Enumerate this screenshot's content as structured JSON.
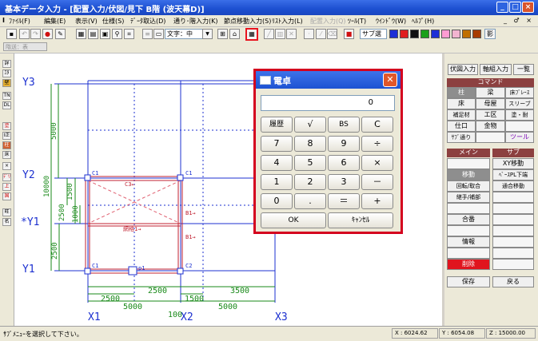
{
  "window": {
    "title": "基本データ入力 - [配置入力/伏図/見下 B階 (波天幕D)]",
    "controls": [
      "_",
      "□",
      "×"
    ]
  },
  "menu": [
    "ﾌｧｲﾙ(F)",
    "編集(E)",
    "表示(V)",
    "仕様(S)",
    "ﾃﾞｰﾀ取込(D)",
    "通り･階入力(K)",
    "節点移動入力(S)",
    "ﾘｽﾄ入力(L)",
    "配置入力(Q)",
    "ﾂｰﾙ(T)",
    "ｳｲﾝﾄﾞｳ(W)",
    "ﾍﾙﾌﾟ(H)"
  ],
  "menu_disabled": [
    "配置入力(Q)"
  ],
  "mdi_controls": "_ ♂ ×",
  "toolbar": {
    "text_select": "文字：中",
    "label_sub": "サブ選",
    "swatch_colors": [
      "#1d2fd6",
      "#e01e1e",
      "#111111",
      "#1aa01a",
      "#1d2fd6",
      "#ff9bd2",
      "#f2b4d0",
      "#c07000",
      "#a83c00"
    ],
    "label_shadow": "影"
  },
  "subbar": {
    "select_value": "階送：表"
  },
  "left_tools": [
    "詳",
    "ｴﾀ",
    "壁",
    "TN",
    "DL",
    "塗",
    "I正",
    "柱",
    "床",
    "×",
    "ﾃﾞﾘ",
    "上",
    "国",
    "旺",
    "名"
  ],
  "drawing": {
    "axis_y": [
      "Y3",
      "Y2",
      "*Y1",
      "Y1"
    ],
    "axis_x": [
      "X1",
      "X2",
      "X3"
    ],
    "dim_vertical": [
      "5000",
      "10000",
      "1500",
      "2500",
      "1000",
      "2500"
    ],
    "dim_horizontal_upper": [
      "2500",
      "3500"
    ],
    "dim_horizontal_mid": [
      "2500",
      "1500"
    ],
    "dim_horizontal_lower": [
      "5000",
      "5000"
    ],
    "dim_total": "100",
    "labels": [
      "C1",
      "C1",
      "C1",
      "C2",
      "C3←",
      "B1→",
      "B1→",
      "p1",
      "網格1→"
    ]
  },
  "calculator": {
    "title": "電卓",
    "display": "0",
    "keys": [
      [
        "履歴",
        "√",
        "BS",
        "C"
      ],
      [
        "7",
        "8",
        "9",
        "÷"
      ],
      [
        "4",
        "5",
        "6",
        "×"
      ],
      [
        "1",
        "2",
        "3",
        "－"
      ],
      [
        "0",
        ".",
        "＝",
        "+"
      ]
    ],
    "ok": "OK",
    "cancel": "ｷｬﾝｾﾙ"
  },
  "right_panel": {
    "top_buttons": [
      "伏図入力",
      "軸組入力",
      "一覧"
    ],
    "command_header": "コマンド",
    "commands": [
      [
        "柱",
        "梁",
        "床ﾌﾞﾚｰｽ"
      ],
      [
        "床",
        "母屋",
        "スリーブ"
      ],
      [
        "補足材",
        "エ区",
        "塗・耐"
      ],
      [
        "仕口",
        "金物",
        ""
      ],
      [
        "ｻﾌﾞ通り",
        "",
        "ツール"
      ]
    ],
    "main_header": "メイン",
    "sub_header": "サブ",
    "main_items": [
      "",
      "移動",
      "回転/取合",
      "継手/補部",
      "",
      "合番",
      "",
      "情報",
      "",
      "削除"
    ],
    "sub_items": [
      "XY移動",
      "ﾍﾞｰｽPL下端",
      "通合移動",
      "",
      "",
      "",
      "",
      "",
      "",
      ""
    ],
    "save": "保存",
    "back": "戻る"
  },
  "status": {
    "message": "ｻﾌﾞﾒﾆｭｰを選択して下さい。",
    "x": "X : 6024.62",
    "y": "Y : 6054.08",
    "z": "Z : 15000.00"
  }
}
